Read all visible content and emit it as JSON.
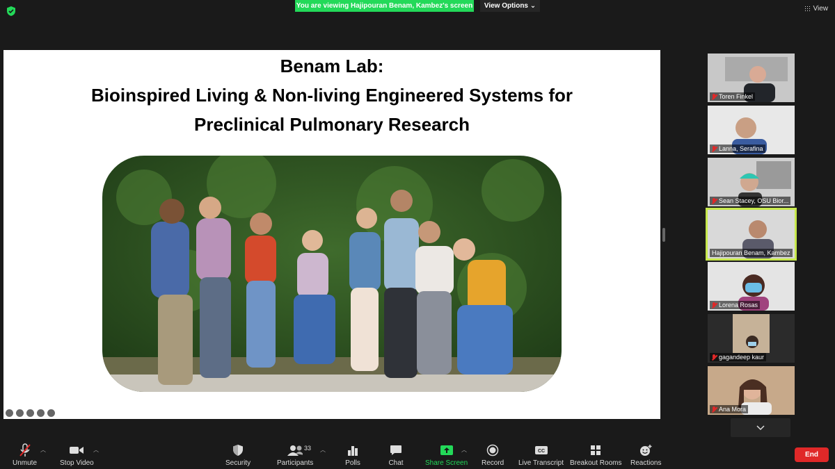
{
  "banner": {
    "viewing_text": "You are viewing Hajipouran Benam, Kambez's screen",
    "view_options": "View Options",
    "view_label": "View"
  },
  "slide": {
    "title_line1": "Benam Lab:",
    "title_line2": "Bioinspired Living & Non-living Engineered Systems for",
    "title_line3": "Preclinical Pulmonary Research"
  },
  "participants": [
    {
      "name": "Toren Finkel",
      "muted": true,
      "active": false
    },
    {
      "name": "Lanna, Serafina",
      "muted": true,
      "active": false
    },
    {
      "name": "Sean Stacey, OSU Bior...",
      "muted": true,
      "active": false
    },
    {
      "name": "Hajipouran Benam, Kambez",
      "muted": false,
      "active": true
    },
    {
      "name": "Lorena Rosas",
      "muted": true,
      "active": false
    },
    {
      "name": "gagandeep kaur",
      "muted": true,
      "active": false
    },
    {
      "name": "Ana Mora",
      "muted": true,
      "active": false
    }
  ],
  "toolbar": {
    "unmute": "Unmute",
    "stop_video": "Stop Video",
    "security": "Security",
    "participants": "Participants",
    "participants_count": "33",
    "polls": "Polls",
    "chat": "Chat",
    "share_screen": "Share Screen",
    "record": "Record",
    "live_transcript": "Live Transcript",
    "breakout_rooms": "Breakout Rooms",
    "reactions": "Reactions",
    "end": "End"
  },
  "colors": {
    "accent_green": "#23d959",
    "end_red": "#e02828",
    "active_border": "#c7e84c"
  }
}
